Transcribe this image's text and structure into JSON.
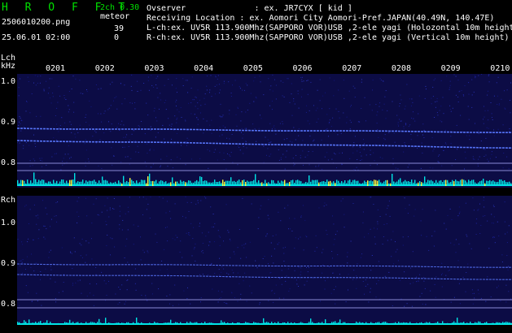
{
  "header": {
    "app_name": "H R O F F T",
    "version": "2ch 0.30",
    "filename": "2506010200.png",
    "datetime": "25.06.01 02:00",
    "detection_label": "meteor",
    "count_lch": "39",
    "count_rch": "0",
    "observer_line": "Ovserver              : ex. JR7CYX [ kid ]",
    "location_line": "Receiving Location : ex. Aomori City Aomori-Pref.JAPAN(40.49N, 140.47E)",
    "lch_line": "L-ch:ex. UV5R 113.900Mhz(SAPPORO VOR)USB ,2-ele yagi (Holozontal 10m height)",
    "rch_line": "R-ch:ex. UV5R 113.900Mhz(SAPPORO VOR)USB ,2-ele yagi (Vertical 10m height)"
  },
  "lch": {
    "label": "Lch",
    "unit": "kHz",
    "ticks": [
      "1.0",
      "0.9",
      "0.8"
    ]
  },
  "rch": {
    "label": "Rch",
    "ticks": [
      "1.0",
      "0.9",
      "0.8"
    ]
  },
  "time_labels": [
    "0201",
    "0202",
    "0203",
    "0204",
    "0205",
    "0206",
    "0207",
    "0208",
    "0209",
    "0210"
  ],
  "colors": {
    "text_green": "#00e000",
    "background": "#000000",
    "panel": "#0c0c45",
    "trace": "#5a78ff",
    "ref_line": "#8a8ad8",
    "level_cyan": "#00e5e5",
    "level_yellow": "#ffff40"
  }
}
